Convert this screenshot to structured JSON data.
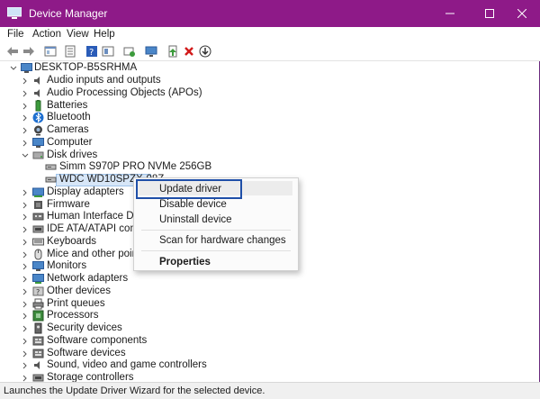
{
  "window": {
    "title": "Device Manager"
  },
  "menu": [
    "File",
    "Action",
    "View",
    "Help"
  ],
  "tree": {
    "root": "DESKTOP-B5SRHMA",
    "categories": [
      {
        "label": "Audio inputs and outputs",
        "icon": "speaker-icon"
      },
      {
        "label": "Audio Processing Objects (APOs)",
        "icon": "speaker-icon"
      },
      {
        "label": "Batteries",
        "icon": "battery-icon"
      },
      {
        "label": "Bluetooth",
        "icon": "bluetooth-icon"
      },
      {
        "label": "Cameras",
        "icon": "camera-icon"
      },
      {
        "label": "Computer",
        "icon": "monitor-icon"
      },
      {
        "label": "Disk drives",
        "icon": "disk-icon"
      },
      {
        "label": "Simm S970P PRO NVMe 256GB",
        "icon": "drive-icon"
      },
      {
        "label": "WDC WD10SPZX-08Z",
        "icon": "drive-icon"
      },
      {
        "label": "Display adapters",
        "icon": "display-adapter-icon"
      },
      {
        "label": "Firmware",
        "icon": "chip-icon"
      },
      {
        "label": "Human Interface Devices",
        "icon": "hid-icon"
      },
      {
        "label": "IDE ATA/ATAPI controllers",
        "icon": "controller-icon"
      },
      {
        "label": "Keyboards",
        "icon": "keyboard-icon"
      },
      {
        "label": "Mice and other pointing",
        "icon": "mouse-icon"
      },
      {
        "label": "Monitors",
        "icon": "monitor-icon"
      },
      {
        "label": "Network adapters",
        "icon": "network-icon"
      },
      {
        "label": "Other devices",
        "icon": "unknown-device-icon"
      },
      {
        "label": "Print queues",
        "icon": "printer-icon"
      },
      {
        "label": "Processors",
        "icon": "cpu-icon"
      },
      {
        "label": "Security devices",
        "icon": "security-icon"
      },
      {
        "label": "Software components",
        "icon": "component-icon"
      },
      {
        "label": "Software devices",
        "icon": "component-icon"
      },
      {
        "label": "Sound, video and game controllers",
        "icon": "speaker-icon"
      },
      {
        "label": "Storage controllers",
        "icon": "controller-icon"
      }
    ]
  },
  "context_menu": {
    "update": "Update driver",
    "disable": "Disable device",
    "uninstall": "Uninstall device",
    "scan": "Scan for hardware changes",
    "properties": "Properties"
  },
  "status": "Launches the Update Driver Wizard for the selected device.",
  "colors": {
    "titlebar": "#8e1a88",
    "focus": "#1f4fa8"
  }
}
